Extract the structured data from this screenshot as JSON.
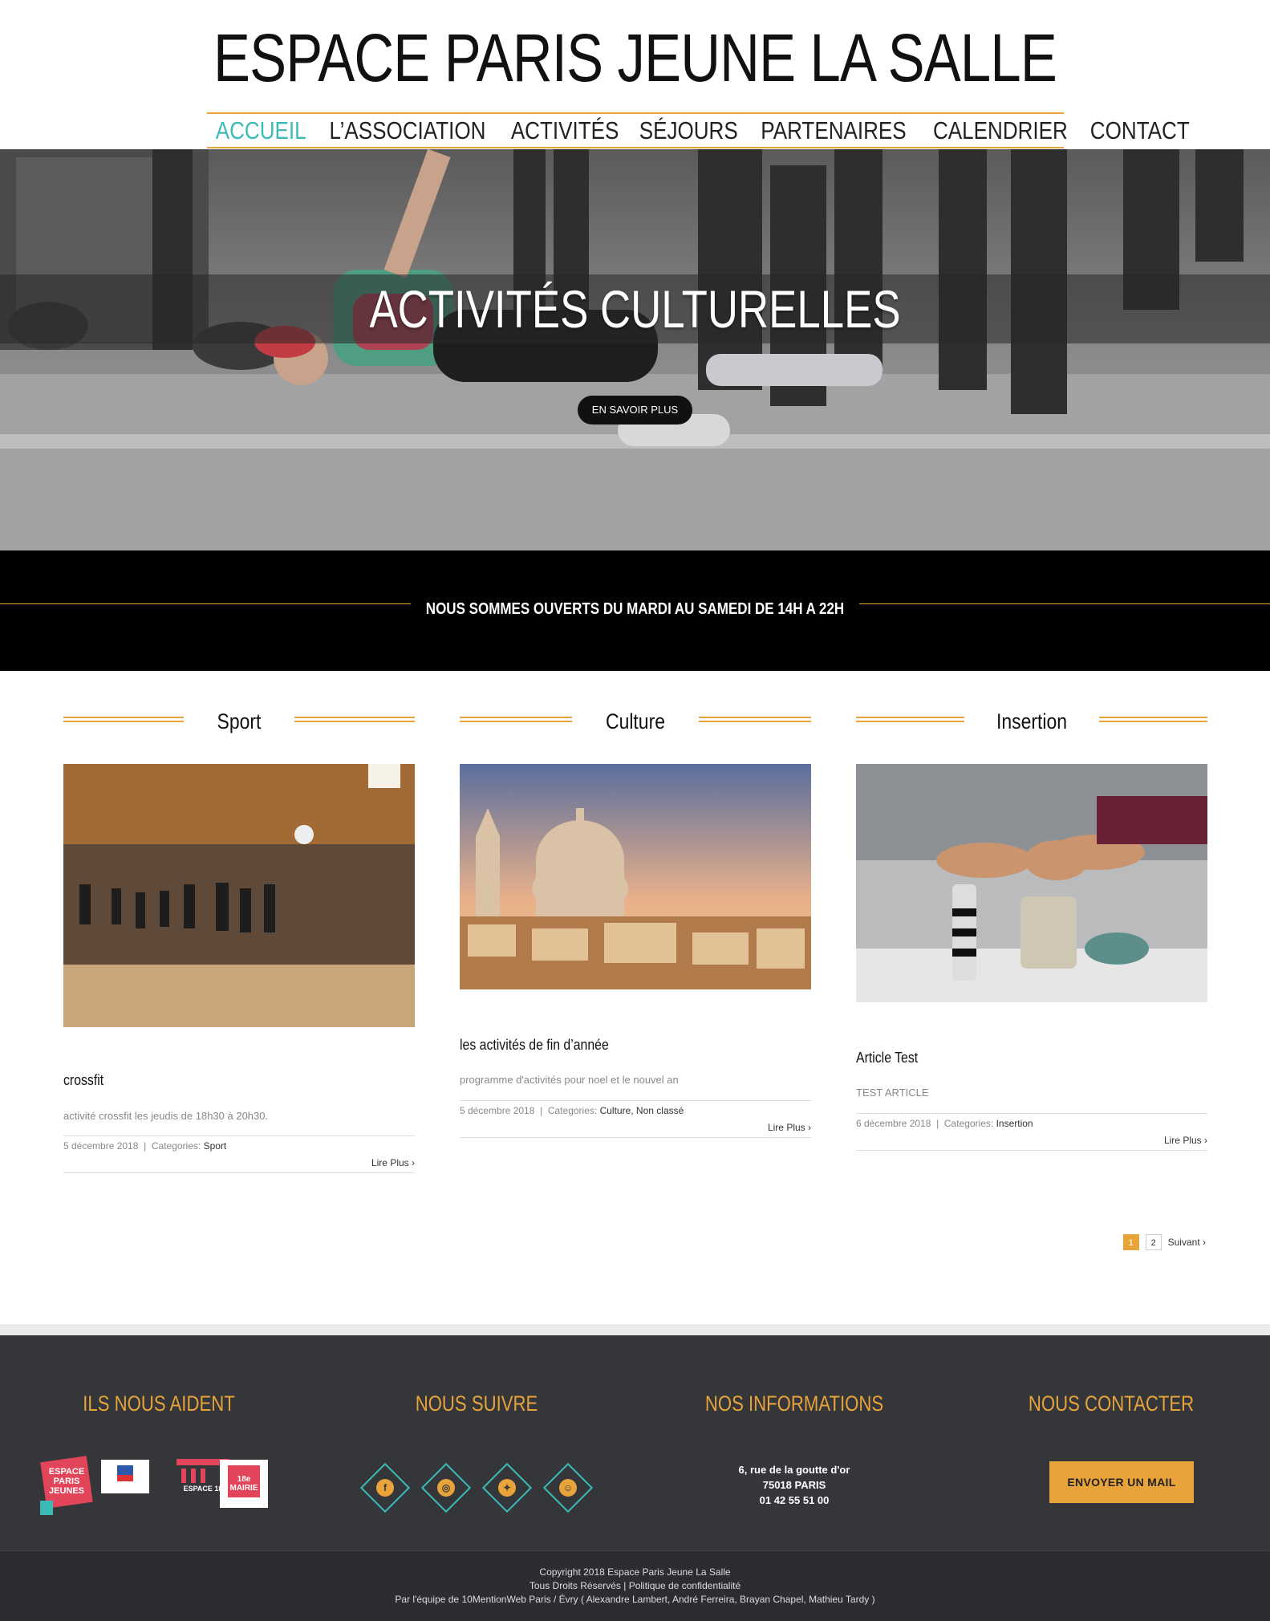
{
  "site": {
    "title": "ESPACE PARIS JEUNE LA SALLE"
  },
  "nav": [
    {
      "label": "ACCUEIL",
      "active": true
    },
    {
      "label": "L’ASSOCIATION"
    },
    {
      "label": "ACTIVITÉS"
    },
    {
      "label": "SÉJOURS"
    },
    {
      "label": "PARTENAIRES"
    },
    {
      "label": "CALENDRIER"
    },
    {
      "label": "CONTACT"
    }
  ],
  "hero": {
    "title": "ACTIVITÉS CULTURELLES",
    "button": "EN SAVOIR PLUS"
  },
  "banner": {
    "text": "NOUS SOMMES OUVERTS DU MARDI AU SAMEDI DE 14H A 22H"
  },
  "columns": [
    {
      "category": "Sport",
      "title": "crossfit",
      "excerpt": "activité crossfit les jeudis de 18h30 à 20h30.",
      "date": "5 décembre 2018",
      "categories_label": "Categories:",
      "categories": "Sport",
      "more": "Lire Plus"
    },
    {
      "category": "Culture",
      "title": "les activités de fin d’année",
      "excerpt": "programme d'activités pour noel et le nouvel an",
      "date": "5 décembre 2018",
      "categories_label": "Categories:",
      "categories": "Culture, Non classé",
      "more": "Lire Plus"
    },
    {
      "category": "Insertion",
      "title": "Article Test",
      "excerpt": "TEST ARTICLE",
      "date": "6 décembre 2018",
      "categories_label": "Categories:",
      "categories": "Insertion",
      "more": "Lire Plus"
    }
  ],
  "pagination": {
    "pages": [
      "1",
      "2"
    ],
    "current": "1",
    "next": "Suivant"
  },
  "footer": {
    "helpers": {
      "heading": "ILS NOUS AIDENT",
      "logo1_text": "ESPACE PARIS JEUNES",
      "logo3_text": "ESPACE 18",
      "logo4_text": "18e MAIRIE"
    },
    "follow": {
      "heading": "NOUS SUIVRE",
      "icons": [
        "facebook-icon",
        "instagram-icon",
        "twitter-icon",
        "snapchat-icon"
      ]
    },
    "info": {
      "heading": "NOS INFORMATIONS",
      "line1": "6, rue de la goutte d'or",
      "line2": "75018 PARIS",
      "line3": "01 42 55 51 00"
    },
    "contact": {
      "heading": "NOUS CONTACTER",
      "button": "ENVOYER UN MAIL"
    },
    "copyright": "Copyright 2018 Espace Paris Jeune La Salle",
    "rights": "Tous Droits Réservés | Politique de confidentialité",
    "credits": "Par l'équipe de 10MentionWeb Paris / Évry ( Alexandre Lambert, André Ferreira, Brayan Chapel, Mathieu Tardy )"
  }
}
